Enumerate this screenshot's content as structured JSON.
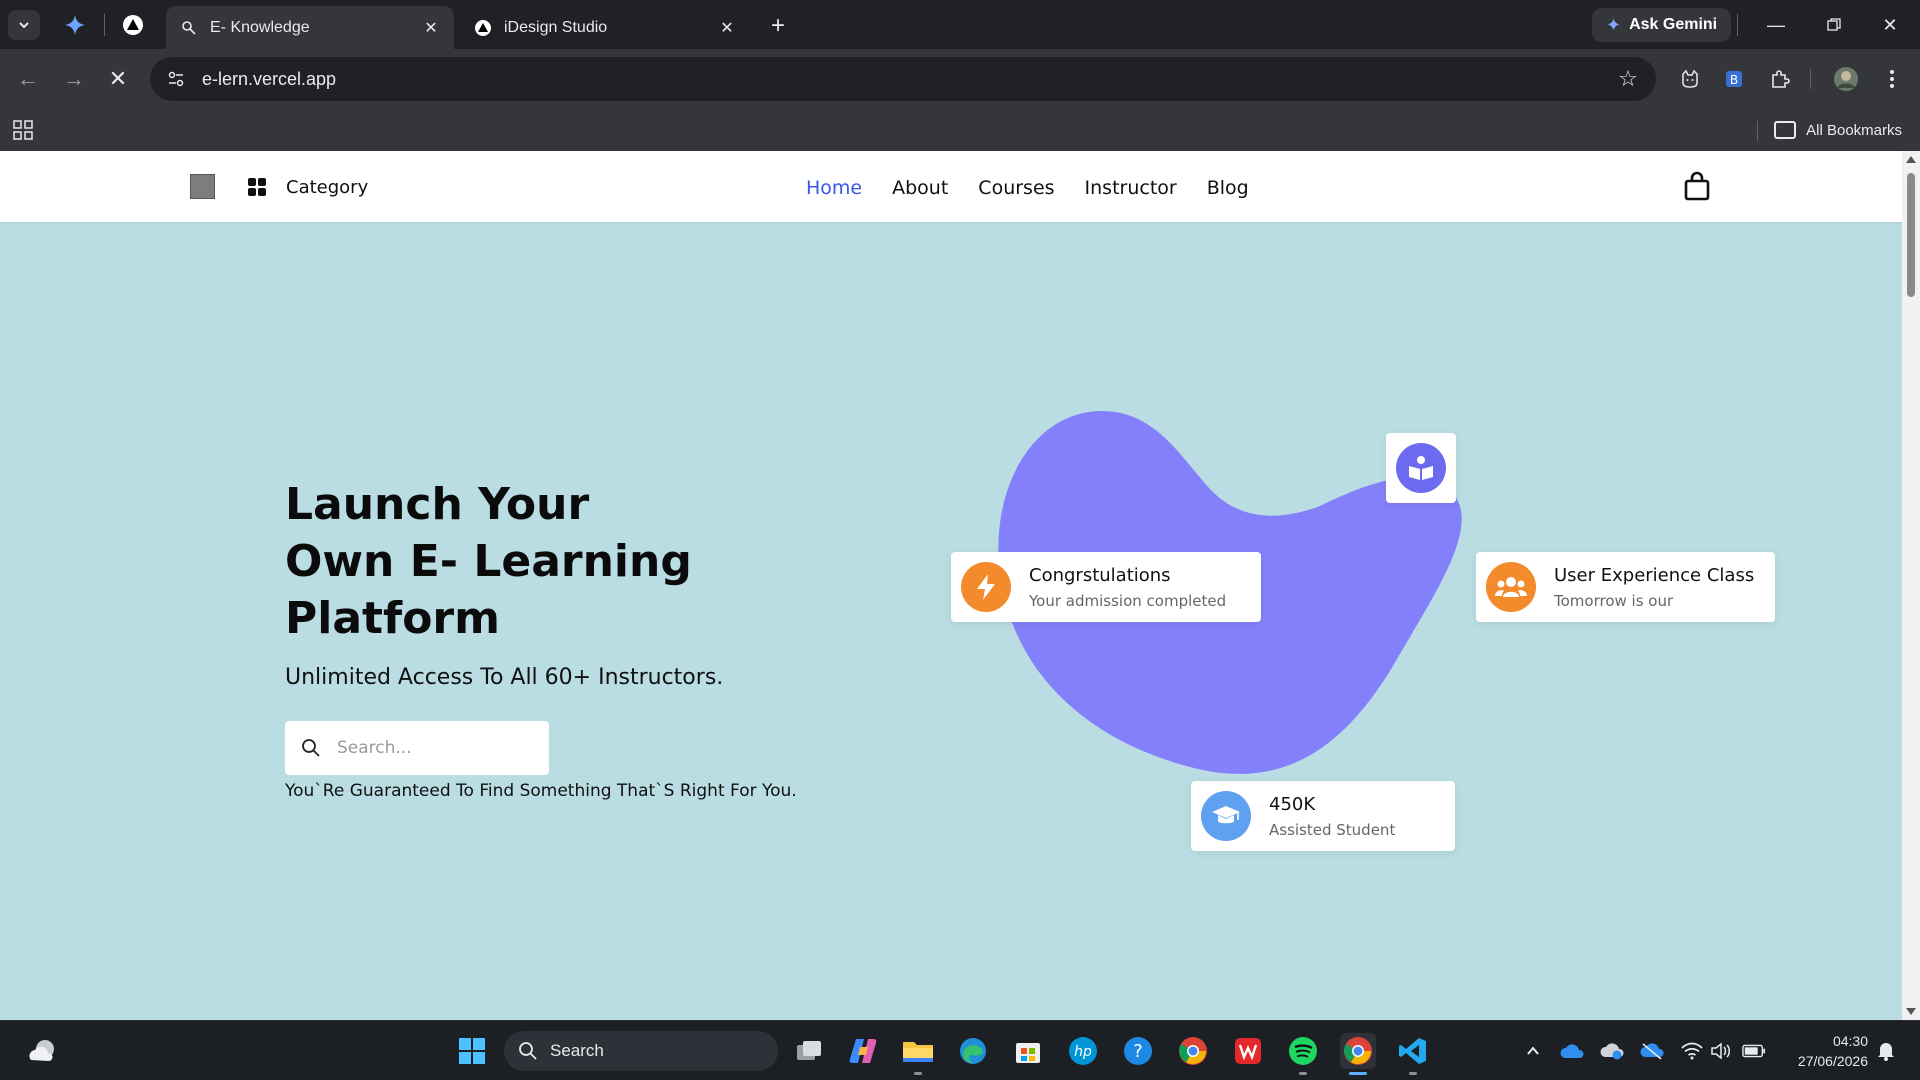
{
  "browser": {
    "tabs": [
      {
        "title": "E- Knowledge",
        "active": true
      },
      {
        "title": "iDesign Studio",
        "active": false
      }
    ],
    "ask_gemini": "Ask Gemini",
    "url": "e-lern.vercel.app",
    "bookmarks_label": "All Bookmarks"
  },
  "site": {
    "category_label": "Category",
    "nav": [
      {
        "label": "Home",
        "active": true
      },
      {
        "label": "About"
      },
      {
        "label": "Courses"
      },
      {
        "label": "Instructor"
      },
      {
        "label": "Blog"
      }
    ],
    "accent_color": "#3a57e8",
    "background_color": "#b9dde2",
    "blob_color": "#8480fb",
    "orange": "#f38a2c",
    "blue": "#5fa0f0"
  },
  "hero": {
    "title_lines": [
      "Launch Your",
      "Own E- Learning",
      "Platform"
    ],
    "subtitle": "Unlimited Access To All 60+ Instructors.",
    "search_placeholder": "Search...",
    "tagline": "You`Re Guaranteed To Find Something That`S Right For You."
  },
  "cards": {
    "congrats": {
      "title": "Congrstulations",
      "subtitle": "Your admission completed",
      "icon": "lightning-icon"
    },
    "ux_class": {
      "title": "User Experience Class",
      "subtitle": "Tomorrow is our",
      "icon": "users-icon"
    },
    "students": {
      "title": "450K",
      "subtitle": "Assisted Student",
      "icon": "graduation-cap-icon"
    },
    "book": {
      "icon": "book-reader-icon"
    }
  },
  "taskbar": {
    "search_label": "Search",
    "time": "04:30",
    "date": "27/06/2026"
  }
}
